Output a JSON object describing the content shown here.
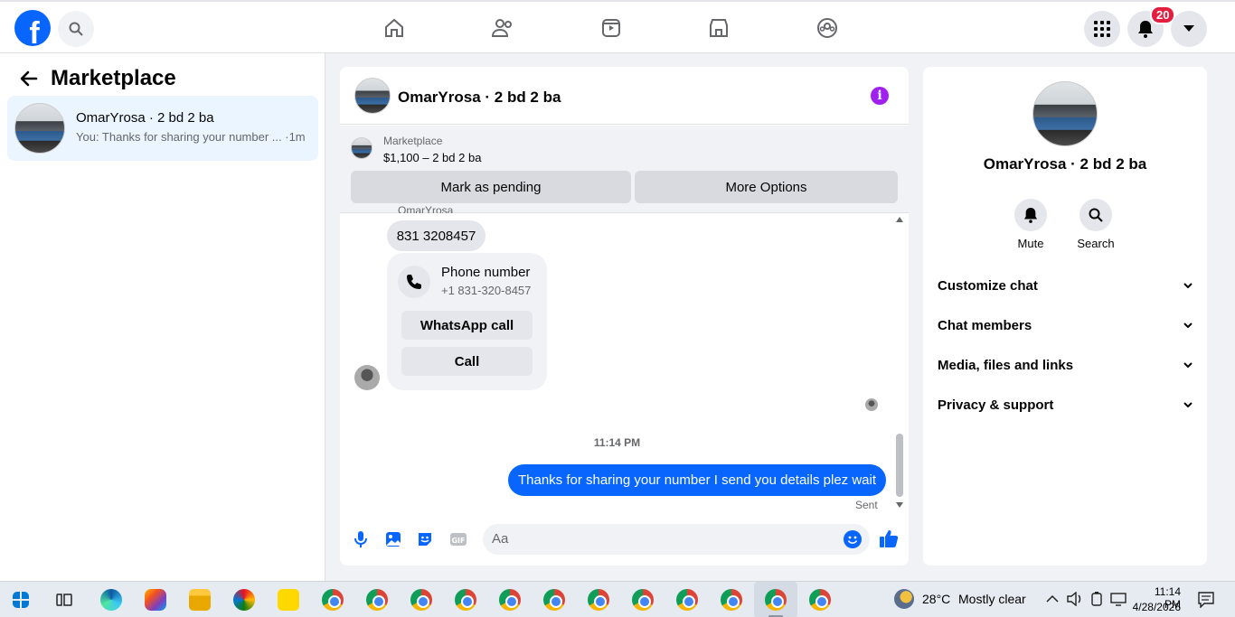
{
  "nav": {
    "notifications_count": "20",
    "brand_color": "#0866ff"
  },
  "left": {
    "title": "Marketplace",
    "conversation": {
      "name": "OmarYrosa · 2 bd 2 ba",
      "snippet": "You: Thanks for sharing your number ... ·1m"
    }
  },
  "chat": {
    "header_name": "OmarYrosa · 2 bd 2 ba",
    "marketplace_label": "Marketplace",
    "listing": "$1,100 – 2 bd 2 ba",
    "buttons": {
      "pending": "Mark as pending",
      "more": "More Options"
    },
    "sender_label": "OmarYrosa",
    "messages": {
      "phone_text": "831 3208457",
      "card_title": "Phone number",
      "card_sub": "+1 831-320-8457",
      "whatsapp": "WhatsApp call",
      "call": "Call"
    },
    "time": "11:14 PM",
    "my_message": "Thanks for sharing your number I send you details plez wait",
    "status": "Sent",
    "composer_placeholder": "Aa"
  },
  "right": {
    "name": "OmarYrosa · 2 bd 2 ba",
    "actions": {
      "mute": "Mute",
      "search": "Search"
    },
    "sections": [
      "Customize chat",
      "Chat members",
      "Media, files and links",
      "Privacy & support"
    ]
  },
  "taskbar": {
    "weather_temp": "28°C",
    "weather_desc": "Mostly clear",
    "clock_time": "11:14 PM",
    "clock_date": "4/28/2026"
  }
}
